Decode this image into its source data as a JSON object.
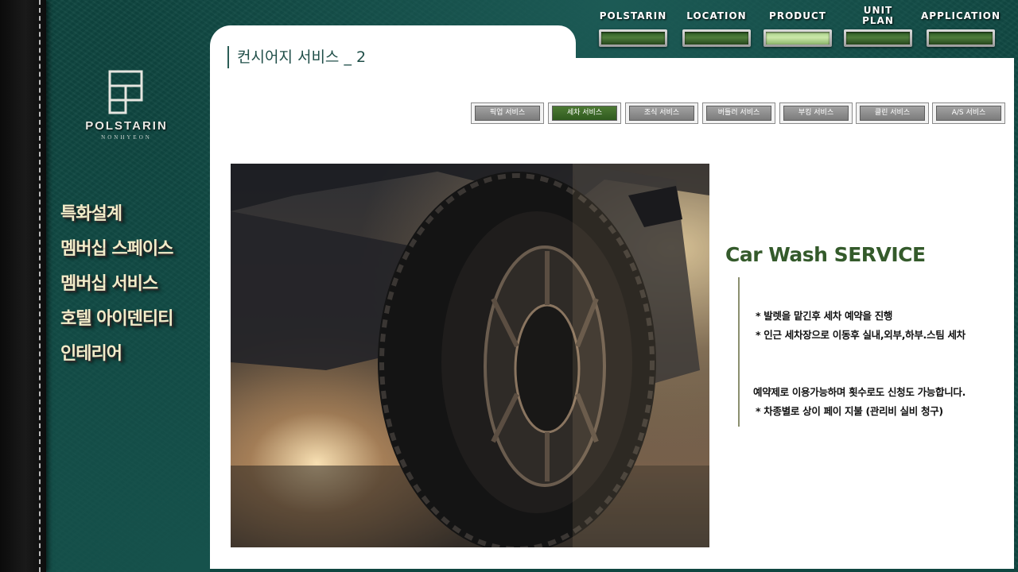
{
  "brand": {
    "name": "POLSTARIN",
    "sub": "NONHYEON"
  },
  "top_nav": [
    {
      "label": "POLSTARIN",
      "active": false
    },
    {
      "label": "LOCATION",
      "active": false
    },
    {
      "label": "PRODUCT",
      "active": true
    },
    {
      "label": "UNIT PLAN",
      "active": false
    },
    {
      "label": "APPLICATION",
      "active": false
    }
  ],
  "left_nav": [
    {
      "label": "특화설계"
    },
    {
      "label": "멤버십 스페이스"
    },
    {
      "label": "멤버십 서비스"
    },
    {
      "label": "호텔 아이덴티티"
    },
    {
      "label": "인테리어"
    }
  ],
  "page": {
    "title": "컨시어지 서비스 _ 2"
  },
  "service_tabs": [
    {
      "label": "픽업 서비스",
      "active": false
    },
    {
      "label": "세차 서비스",
      "active": true
    },
    {
      "label": "조식 서비스",
      "active": false
    },
    {
      "label": "버틀러 서비스",
      "active": false
    },
    {
      "label": "부킹 서비스",
      "active": false
    },
    {
      "label": "클린 서비스",
      "active": false
    },
    {
      "label": "A/S 서비스",
      "active": false
    }
  ],
  "service": {
    "heading": "Car Wash SERVICE",
    "lines": [
      "* 발렛을 맡긴후 세차 예약을 진행",
      "* 인근 세차장으로 이동후 실내,외부,하부.스팀 세차",
      "예약제로 이용가능하며 횟수로도 신청도 가능합니다.",
      "* 차종별로 상이 페이 지불 (관리비 실비 청구)"
    ]
  },
  "colors": {
    "background_teal": "#0f4640",
    "heading_green": "#345a2b",
    "active_tab_green": "#2f5a1e",
    "nav_text": "#f2ecc9"
  }
}
